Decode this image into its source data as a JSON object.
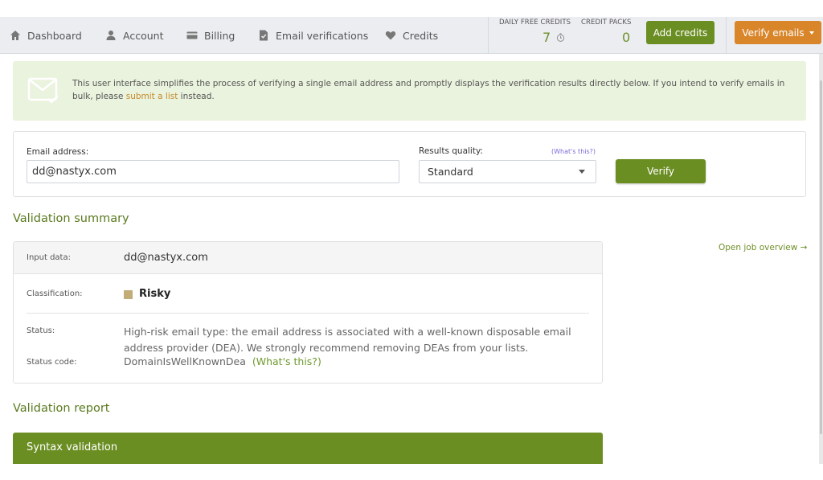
{
  "nav": {
    "items": [
      {
        "label": "Dashboard",
        "icon": "home-icon"
      },
      {
        "label": "Account",
        "icon": "user-icon"
      },
      {
        "label": "Billing",
        "icon": "credit-card-icon"
      },
      {
        "label": "Email verifications",
        "icon": "document-check-icon"
      },
      {
        "label": "Credits",
        "icon": "heart-icon"
      }
    ],
    "daily_free_credits_label": "DAILY FREE CREDITS",
    "daily_free_credits_value": "7",
    "credit_packs_label": "CREDIT PACKS",
    "credit_packs_value": "0",
    "add_credits_label": "Add credits",
    "verify_emails_label": "Verify emails"
  },
  "banner": {
    "text_before_link": "This user interface simplifies the process of verifying a single email address and promptly displays the verification results directly below. If you intend to verify emails in bulk, please ",
    "link_text": "submit a list",
    "text_after_link": " instead."
  },
  "form": {
    "email_label": "Email address:",
    "email_value": "dd@nastyx.com",
    "quality_label": "Results quality:",
    "quality_help": "(What's this?)",
    "quality_value": "Standard",
    "verify_label": "Verify"
  },
  "summary": {
    "title": "Validation summary",
    "open_job_label": "Open job overview →",
    "input_label": "Input data:",
    "input_value": "dd@nastyx.com",
    "classification_label": "Classification:",
    "classification_value": "Risky",
    "classification_color": "#c2ad78",
    "status_label": "Status:",
    "status_value": "High-risk email type: the email address is associated with a well-known disposable email address provider (DEA). We strongly recommend removing DEAs from your lists.",
    "status_code_label": "Status code:",
    "status_code_value": "DomainIsWellKnownDea",
    "status_code_help": "(What's this?)"
  },
  "report": {
    "title": "Validation report",
    "syntax_label": "Syntax validation"
  },
  "colors": {
    "brand_green": "#6b8e23",
    "brand_orange": "#d9862b",
    "banner_bg": "#eaf3dd"
  }
}
